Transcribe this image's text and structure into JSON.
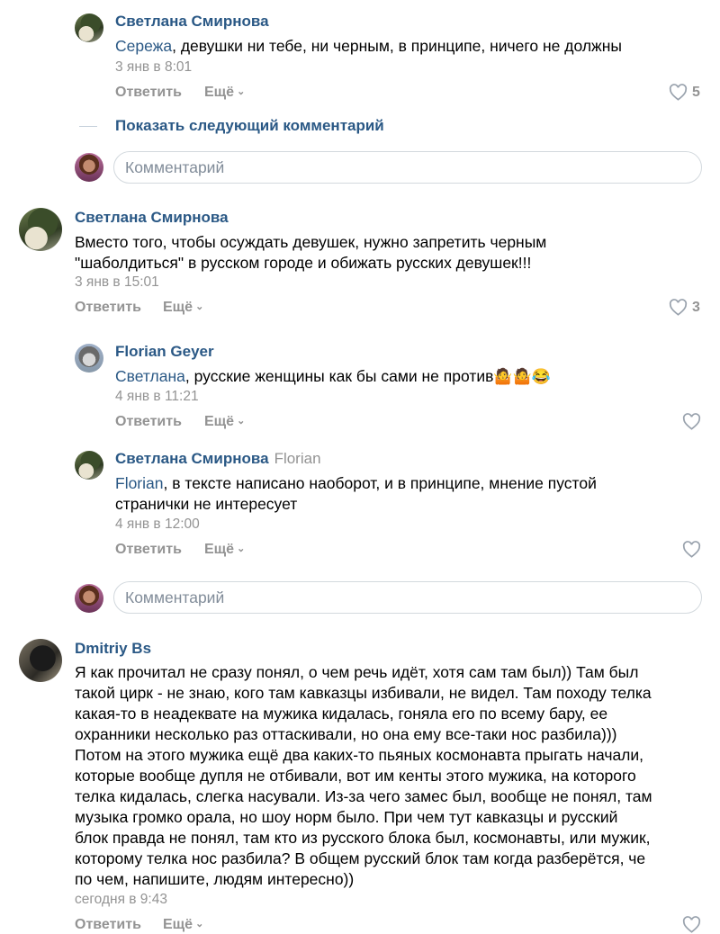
{
  "comments": [
    {
      "author": "Светлана Смирнова",
      "mention": "Сережа",
      "text": ", девушки ни тебе, ни черным, в принципе, ничего не должны",
      "date": "3 янв в 8:01",
      "reply_label": "Ответить",
      "more_label": "Ещё",
      "likes": "5"
    },
    {
      "author": "Светлана Смирнова",
      "text_lines": [
        "Вместо того, чтобы осуждать девушек, нужно запретить черным",
        "\"шаболдиться\" в русском городе и обижать русских девушек!!!"
      ],
      "date": "3 янв в 15:01",
      "reply_label": "Ответить",
      "more_label": "Ещё",
      "likes": "3"
    },
    {
      "author": "Florian Geyer",
      "mention": "Светлана",
      "text": ", русские женщины как бы сами не против",
      "emojis": "🤷🤷😂",
      "date": "4 янв в 11:21",
      "reply_label": "Ответить",
      "more_label": "Ещё"
    },
    {
      "author": "Светлана Смирнова",
      "reply_to": "Florian",
      "mention": "Florian",
      "text_line1": ", в тексте написано наоборот, и в принципе, мнение пустой",
      "text_line2": "странички не интересует",
      "date": "4 янв в 12:00",
      "reply_label": "Ответить",
      "more_label": "Ещё"
    },
    {
      "author": "Dmitriy Bs",
      "text_lines": [
        "Я как прочитал не сразу понял, о чем речь идёт, хотя сам там был)) Там был",
        "такой цирк - не знаю, кого там кавказцы избивали, не видел. Там походу телка",
        "какая-то в неадеквате на мужика кидалась, гоняла его по всему бару, ее",
        "охранники несколько раз оттаскивали, но она ему все-таки нос разбила)))",
        "Потом на этого мужика ещё два каких-то пьяных космонавта прыгать начали,",
        "которые вообще дупля не отбивали, вот им кенты этого мужика, на которого",
        "телка кидалась, слегка насували. Из-за чего замес был, вообще не понял, там",
        "музыка громко орала, но шоу норм было. При чем тут кавказцы и русский",
        "блок правда не понял, там кто из русского блока был, космонавты, или мужик,",
        "которому телка нос разбила? В общем русский блок там когда разберётся, че",
        "по чем, напишите, людям интересно))"
      ],
      "date": "сегодня в 9:43",
      "reply_label": "Ответить",
      "more_label": "Ещё"
    }
  ],
  "show_next_label": "Показать следующий комментарий",
  "comment_input_placeholder": "Комментарий",
  "icons": {
    "like": "heart-icon",
    "more_chevron": "chevron-down-icon"
  },
  "colors": {
    "link": "#2a5885",
    "meta": "#939393",
    "border": "#d3d9de"
  }
}
